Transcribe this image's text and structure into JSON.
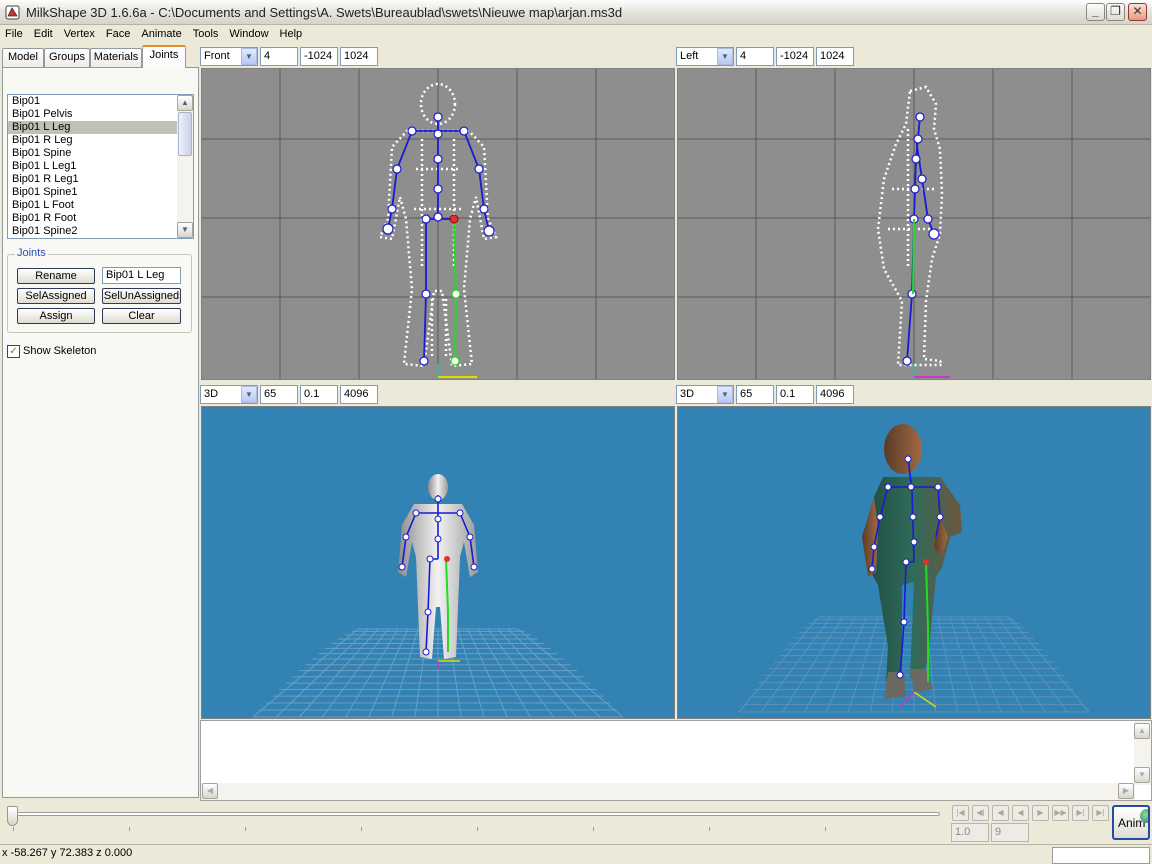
{
  "window": {
    "title": "MilkShape 3D 1.6.6a - C:\\Documents and Settings\\A. Swets\\Bureaublad\\swets\\Nieuwe map\\arjan.ms3d",
    "minimize": "_",
    "maximize": "❐",
    "close": "✕"
  },
  "menu": [
    "File",
    "Edit",
    "Vertex",
    "Face",
    "Animate",
    "Tools",
    "Window",
    "Help"
  ],
  "tabs": [
    "Model",
    "Groups",
    "Materials",
    "Joints"
  ],
  "active_tab": "Joints",
  "joint_list": {
    "items": [
      "Bip01",
      "Bip01 Pelvis",
      "Bip01 L Leg",
      "Bip01 R Leg",
      "Bip01 Spine",
      "Bip01 L Leg1",
      "Bip01 R Leg1",
      "Bip01 Spine1",
      "Bip01 L Foot",
      "Bip01 R Foot",
      "Bip01 Spine2"
    ],
    "selected": "Bip01 L Leg"
  },
  "joints_group": {
    "label": "Joints",
    "rename": "Rename",
    "name_value": "Bip01 L Leg",
    "sel_assigned": "SelAssigned",
    "sel_unassigned": "SelUnAssigned",
    "assign": "Assign",
    "clear": "Clear"
  },
  "show_skeleton": {
    "label": "Show Skeleton",
    "checked": true,
    "mark": "✓"
  },
  "viewports": {
    "front": {
      "view": "Front",
      "f1": "4",
      "f2": "-1024",
      "f3": "1024"
    },
    "left": {
      "view": "Left",
      "f1": "4",
      "f2": "-1024",
      "f3": "1024"
    },
    "bottom_left": {
      "view": "3D",
      "f1": "65",
      "f2": "0.1",
      "f3": "4096"
    },
    "bottom_right": {
      "view": "3D",
      "f1": "65",
      "f2": "0.1",
      "f3": "4096"
    }
  },
  "icons": {
    "dropdown": "▼",
    "up": "▲",
    "down": "▼",
    "left": "◀",
    "right": "▶",
    "nav": [
      "|◀",
      "◀|",
      "◀",
      "◀",
      "▶",
      "▶▶",
      "▶|",
      "▶|"
    ]
  },
  "timeline": {
    "position": 0,
    "frame": "1.0",
    "total": "9"
  },
  "anim_button": "Anim",
  "status": "x -58.267 y 72.383 z 0.000",
  "colors": {
    "viewport_3d_bg": "#3282b4",
    "ortho_bg": "#8e8e8e",
    "skeleton": "#1a1ad6",
    "selected_bone": "#22dd22",
    "tab_accent": "#e68b2c"
  }
}
